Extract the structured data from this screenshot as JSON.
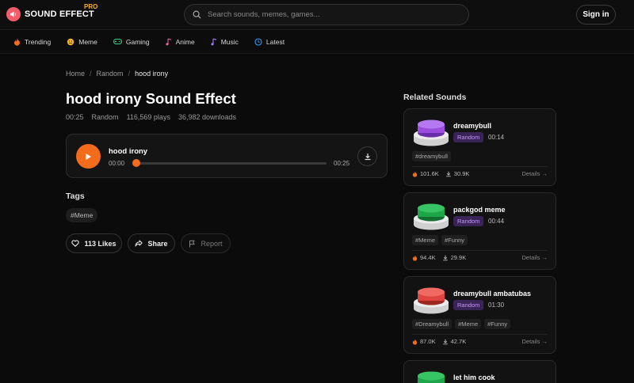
{
  "header": {
    "logo_text": "SOUND EFFECT",
    "logo_badge": "PRO",
    "search_placeholder": "Search sounds, memes, games...",
    "signin_label": "Sign in"
  },
  "nav": {
    "items": [
      {
        "label": "Trending",
        "icon": "fire-icon",
        "color": "#f26c1b"
      },
      {
        "label": "Meme",
        "icon": "smile-icon",
        "color": "#f6b21b"
      },
      {
        "label": "Gaming",
        "icon": "gamepad-icon",
        "color": "#3ecf8e"
      },
      {
        "label": "Anime",
        "icon": "music-note-icon",
        "color": "#f25c9b"
      },
      {
        "label": "Music",
        "icon": "music-note-icon",
        "color": "#a77bff"
      },
      {
        "label": "Latest",
        "icon": "clock-icon",
        "color": "#3b9cff"
      }
    ]
  },
  "breadcrumb": {
    "home": "Home",
    "category": "Random",
    "current": "hood irony"
  },
  "sound": {
    "title": "hood irony Sound Effect",
    "duration": "00:25",
    "category": "Random",
    "plays": "116,569 plays",
    "downloads": "36,982 downloads"
  },
  "player": {
    "name": "hood irony",
    "current_time": "00:00",
    "total_time": "00:25",
    "progress": 0,
    "accent": "#f26c1b"
  },
  "tags": {
    "heading": "Tags",
    "items": [
      "#Meme"
    ]
  },
  "actions": {
    "likes_label": "113 Likes",
    "share_label": "Share",
    "report_label": "Report"
  },
  "related": {
    "heading": "Related Sounds",
    "details_label": "Details →",
    "items": [
      {
        "name": "dreamybull",
        "category": "Random",
        "duration": "00:14",
        "tags": [
          "#dreamybull"
        ],
        "plays": "101.6K",
        "downloads": "30.9K",
        "color": "#9b4de0"
      },
      {
        "name": "packgod meme",
        "category": "Random",
        "duration": "00:44",
        "tags": [
          "#Meme",
          "#Funny"
        ],
        "plays": "94.4K",
        "downloads": "29.9K",
        "color": "#1fa64a"
      },
      {
        "name": "dreamybull ambatubas",
        "category": "Random",
        "duration": "01:30",
        "tags": [
          "#Dreamybull",
          "#Meme",
          "#Funny"
        ],
        "plays": "87.0K",
        "downloads": "42.7K",
        "color": "#e0443e"
      },
      {
        "name": "let him cook",
        "color": "#1fa64a"
      }
    ]
  }
}
